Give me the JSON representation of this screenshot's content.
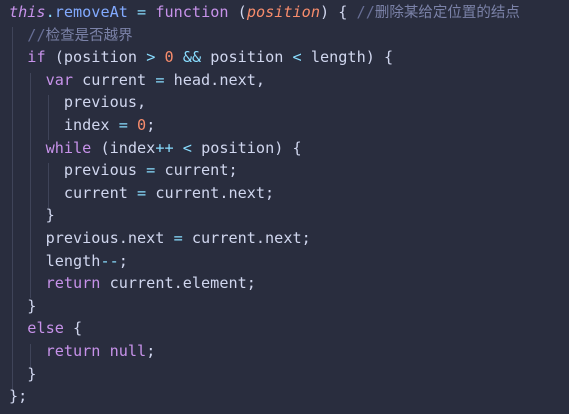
{
  "code": {
    "lines": [
      [
        {
          "t": "this",
          "c": "kwi"
        },
        {
          "t": ".",
          "c": "op"
        },
        {
          "t": "removeAt",
          "c": "fn"
        },
        {
          "t": " ",
          "c": "plain"
        },
        {
          "t": "=",
          "c": "op"
        },
        {
          "t": " ",
          "c": "plain"
        },
        {
          "t": "function",
          "c": "kw"
        },
        {
          "t": " (",
          "c": "plain"
        },
        {
          "t": "position",
          "c": "param"
        },
        {
          "t": ") { ",
          "c": "plain"
        },
        {
          "t": "//",
          "c": "cmt"
        },
        {
          "t": "删除某给定位置的结点",
          "c": "cmtcn"
        }
      ],
      [
        {
          "t": "  ",
          "c": "plain"
        },
        {
          "t": "//",
          "c": "cmt"
        },
        {
          "t": "检查是否越界",
          "c": "cmtcn"
        }
      ],
      [
        {
          "t": "  ",
          "c": "plain"
        },
        {
          "t": "if",
          "c": "kw"
        },
        {
          "t": " (position ",
          "c": "plain"
        },
        {
          "t": ">",
          "c": "op"
        },
        {
          "t": " ",
          "c": "plain"
        },
        {
          "t": "0",
          "c": "num"
        },
        {
          "t": " ",
          "c": "plain"
        },
        {
          "t": "&&",
          "c": "op"
        },
        {
          "t": " position ",
          "c": "plain"
        },
        {
          "t": "<",
          "c": "op"
        },
        {
          "t": " length) {",
          "c": "plain"
        }
      ],
      [
        {
          "t": "    ",
          "c": "plain"
        },
        {
          "t": "var",
          "c": "kw"
        },
        {
          "t": " current ",
          "c": "plain"
        },
        {
          "t": "=",
          "c": "op"
        },
        {
          "t": " head.next,",
          "c": "plain"
        }
      ],
      [
        {
          "t": "      previous,",
          "c": "plain"
        }
      ],
      [
        {
          "t": "      index ",
          "c": "plain"
        },
        {
          "t": "=",
          "c": "op"
        },
        {
          "t": " ",
          "c": "plain"
        },
        {
          "t": "0",
          "c": "num"
        },
        {
          "t": ";",
          "c": "plain"
        }
      ],
      [
        {
          "t": "    ",
          "c": "plain"
        },
        {
          "t": "while",
          "c": "kw"
        },
        {
          "t": " (index",
          "c": "plain"
        },
        {
          "t": "++",
          "c": "op"
        },
        {
          "t": " ",
          "c": "plain"
        },
        {
          "t": "<",
          "c": "op"
        },
        {
          "t": " position) {",
          "c": "plain"
        }
      ],
      [
        {
          "t": "      previous ",
          "c": "plain"
        },
        {
          "t": "=",
          "c": "op"
        },
        {
          "t": " current;",
          "c": "plain"
        }
      ],
      [
        {
          "t": "      current ",
          "c": "plain"
        },
        {
          "t": "=",
          "c": "op"
        },
        {
          "t": " current.next;",
          "c": "plain"
        }
      ],
      [
        {
          "t": "    }",
          "c": "plain"
        }
      ],
      [
        {
          "t": "    previous.next ",
          "c": "plain"
        },
        {
          "t": "=",
          "c": "op"
        },
        {
          "t": " current.next;",
          "c": "plain"
        }
      ],
      [
        {
          "t": "    length",
          "c": "plain"
        },
        {
          "t": "--",
          "c": "op"
        },
        {
          "t": ";",
          "c": "plain"
        }
      ],
      [
        {
          "t": "    ",
          "c": "plain"
        },
        {
          "t": "return",
          "c": "kw"
        },
        {
          "t": " current.element;",
          "c": "plain"
        }
      ],
      [
        {
          "t": "  }",
          "c": "plain"
        }
      ],
      [
        {
          "t": "  ",
          "c": "plain"
        },
        {
          "t": "else",
          "c": "kw"
        },
        {
          "t": " {",
          "c": "plain"
        }
      ],
      [
        {
          "t": "    ",
          "c": "plain"
        },
        {
          "t": "return",
          "c": "kw"
        },
        {
          "t": " ",
          "c": "plain"
        },
        {
          "t": "null",
          "c": "kw"
        },
        {
          "t": ";",
          "c": "plain"
        }
      ],
      [
        {
          "t": "  }",
          "c": "plain"
        }
      ],
      [
        {
          "t": "};",
          "c": "plain"
        }
      ]
    ]
  },
  "colors": {
    "background": "#292d3e",
    "plain": "#d0d6ee",
    "keyword": "#c792ea",
    "function": "#82aaff",
    "operator": "#89ddff",
    "number": "#f78c6c",
    "comment": "#676e95"
  }
}
